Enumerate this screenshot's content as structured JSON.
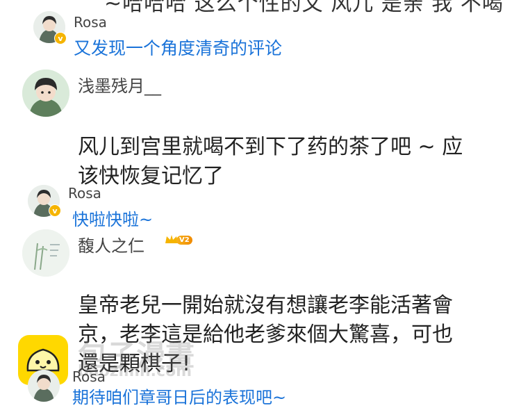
{
  "top_partial_text": "~哈哈哈 这么个性的文 风儿 是亲 我 不喝",
  "threads": [
    {
      "reply_author": "Rosa",
      "reply_text": "又发现一个角度清奇的评论"
    },
    {
      "author": "浅墨残月__",
      "body_line1": "风儿到宫里就喝不到下了药的茶了吧 ~ 应",
      "body_line2": "该快恢复记忆了",
      "reply_author": "Rosa",
      "reply_text": "快啦快啦~"
    },
    {
      "author": "馥人之仁",
      "vip_level": "V2",
      "body_line1": "皇帝老兒一開始就沒有想讓老李能活著會",
      "body_line2": "京，老李這是給他老爹來個大驚喜，可也",
      "body_line3": "還是顆棋子!",
      "reply_author": "Rosa",
      "reply_text": "期待咱们章哥日后的表现吧~"
    }
  ],
  "watermark": {
    "title": "包子漫畫",
    "url": "baozimh.com"
  },
  "colors": {
    "reply_blue": "#1a73d9",
    "verified_gold": "#f5b400",
    "logo_yellow": "#ffd800"
  }
}
